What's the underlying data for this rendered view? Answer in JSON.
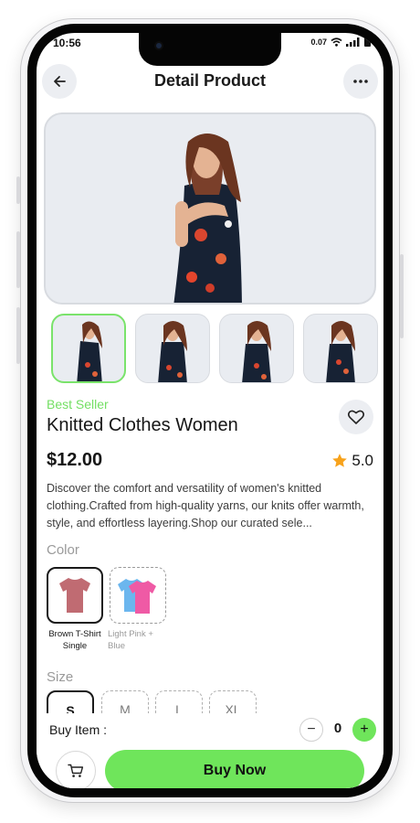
{
  "status_bar": {
    "time": "10:56",
    "speed": "0.07",
    "speed_unit": "KB/S"
  },
  "header": {
    "title": "Detail Product"
  },
  "product": {
    "badge": "Best Seller",
    "name": "Knitted Clothes Women",
    "price": "$12.00",
    "rating": "5.0",
    "description": "Discover the comfort and versatility of women's knitted clothing.Crafted from high-quality yarns, our knits offer warmth, style, and effortless layering.Shop our curated sele..."
  },
  "colors": [
    {
      "label": "Brown T-Shirt Single",
      "selected": true,
      "swatch": "#c06b72"
    },
    {
      "label": "Light Pink + Blue",
      "selected": false,
      "swatch": "#ef5aa5"
    }
  ],
  "sections": {
    "color_label": "Color",
    "size_label": "Size"
  },
  "sizes": [
    {
      "label": "S",
      "selected": true
    },
    {
      "label": "M",
      "selected": false
    },
    {
      "label": "L",
      "selected": false
    },
    {
      "label": "XL",
      "selected": false
    }
  ],
  "purchase": {
    "buy_item_label": "Buy Item :",
    "quantity": "0",
    "minus": "−",
    "plus": "+",
    "buy_now_label": "Buy Now"
  },
  "accent_colors": {
    "green": "#6fe55b",
    "star": "#f7a21b"
  }
}
